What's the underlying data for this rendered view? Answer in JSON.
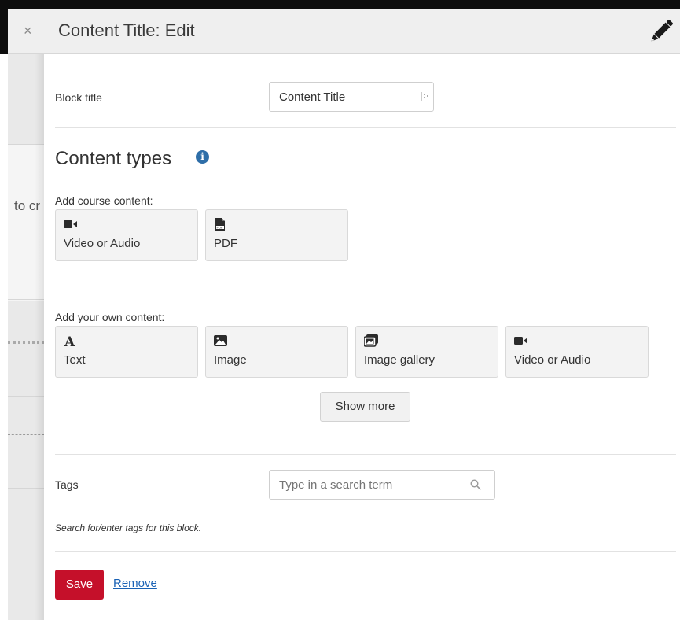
{
  "window": {
    "close_glyph": "×",
    "title": "Content Title: Edit"
  },
  "background_page": {
    "partial_text": "to cr"
  },
  "block_title": {
    "label": "Block title",
    "value": "Content Title"
  },
  "content_types": {
    "heading": "Content types",
    "info_glyph": "i",
    "course_group_label": "Add course content:",
    "course_items": [
      {
        "label": "Video or Audio",
        "icon": "video-camera-icon"
      },
      {
        "label": "PDF",
        "icon": "pdf-file-icon"
      }
    ],
    "own_group_label": "Add your own content:",
    "own_items": [
      {
        "label": "Text",
        "icon": "text-a-icon"
      },
      {
        "label": "Image",
        "icon": "image-icon"
      },
      {
        "label": "Image gallery",
        "icon": "image-gallery-icon"
      },
      {
        "label": "Video or Audio",
        "icon": "video-camera-icon"
      }
    ],
    "show_more_label": "Show more"
  },
  "tags": {
    "label": "Tags",
    "placeholder": "Type in a search term",
    "help_text": "Search for/enter tags for this block."
  },
  "actions": {
    "save_label": "Save",
    "remove_label": "Remove"
  },
  "colors": {
    "save_button": "#c5102a",
    "link": "#1a62b5",
    "info_icon": "#2e6ea8",
    "header_bg": "#efefef"
  }
}
